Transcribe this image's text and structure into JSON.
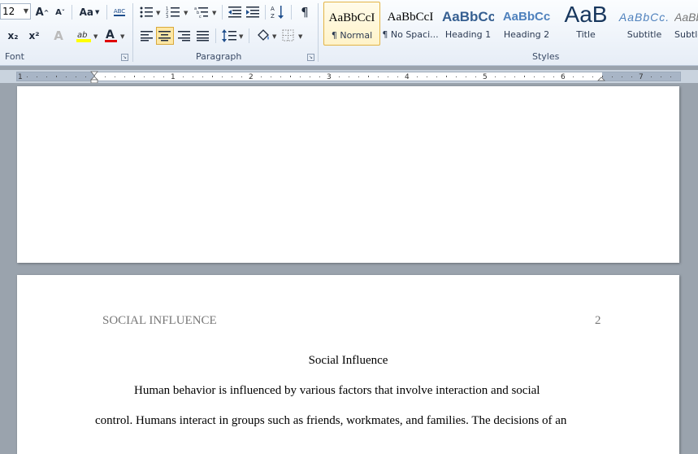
{
  "font": {
    "size_value": "12",
    "grow_label": "A",
    "shrink_label": "A",
    "change_case_label": "Aa",
    "clear_format_label": "ABC",
    "subscript_label": "x₂",
    "superscript_label": "x²",
    "group_label": "Font"
  },
  "paragraph": {
    "group_label": "Paragraph"
  },
  "styles": {
    "group_label": "Styles",
    "items": [
      {
        "sample": "AaBbCcI",
        "name": "¶ Normal"
      },
      {
        "sample": "AaBbCcI",
        "name": "¶ No Spaci..."
      },
      {
        "sample": "AaBbCc",
        "name": "Heading 1"
      },
      {
        "sample": "AaBbCc",
        "name": "Heading 2"
      },
      {
        "sample": "AaB",
        "name": "Title"
      },
      {
        "sample": "AaBbCc.",
        "name": "Subtitle"
      },
      {
        "sample": "AaBbC",
        "name": "Subtle"
      }
    ]
  },
  "ruler": {
    "numbers": [
      "1",
      "1",
      "2",
      "3",
      "4",
      "5",
      "6",
      "7"
    ]
  },
  "document": {
    "running_head": "SOCIAL INFLUENCE",
    "page_number": "2",
    "title": "Social Influence",
    "line1": "Human behavior is influenced by various  factors that involve interaction and social",
    "line2": "control. Humans interact in groups such as friends, workmates, and families.  The decisions of an"
  },
  "colors": {
    "highlight": "#ffff00",
    "font_color": "#e00000",
    "selected_style": "#fde7a4",
    "heading_blue": "#365f91"
  }
}
